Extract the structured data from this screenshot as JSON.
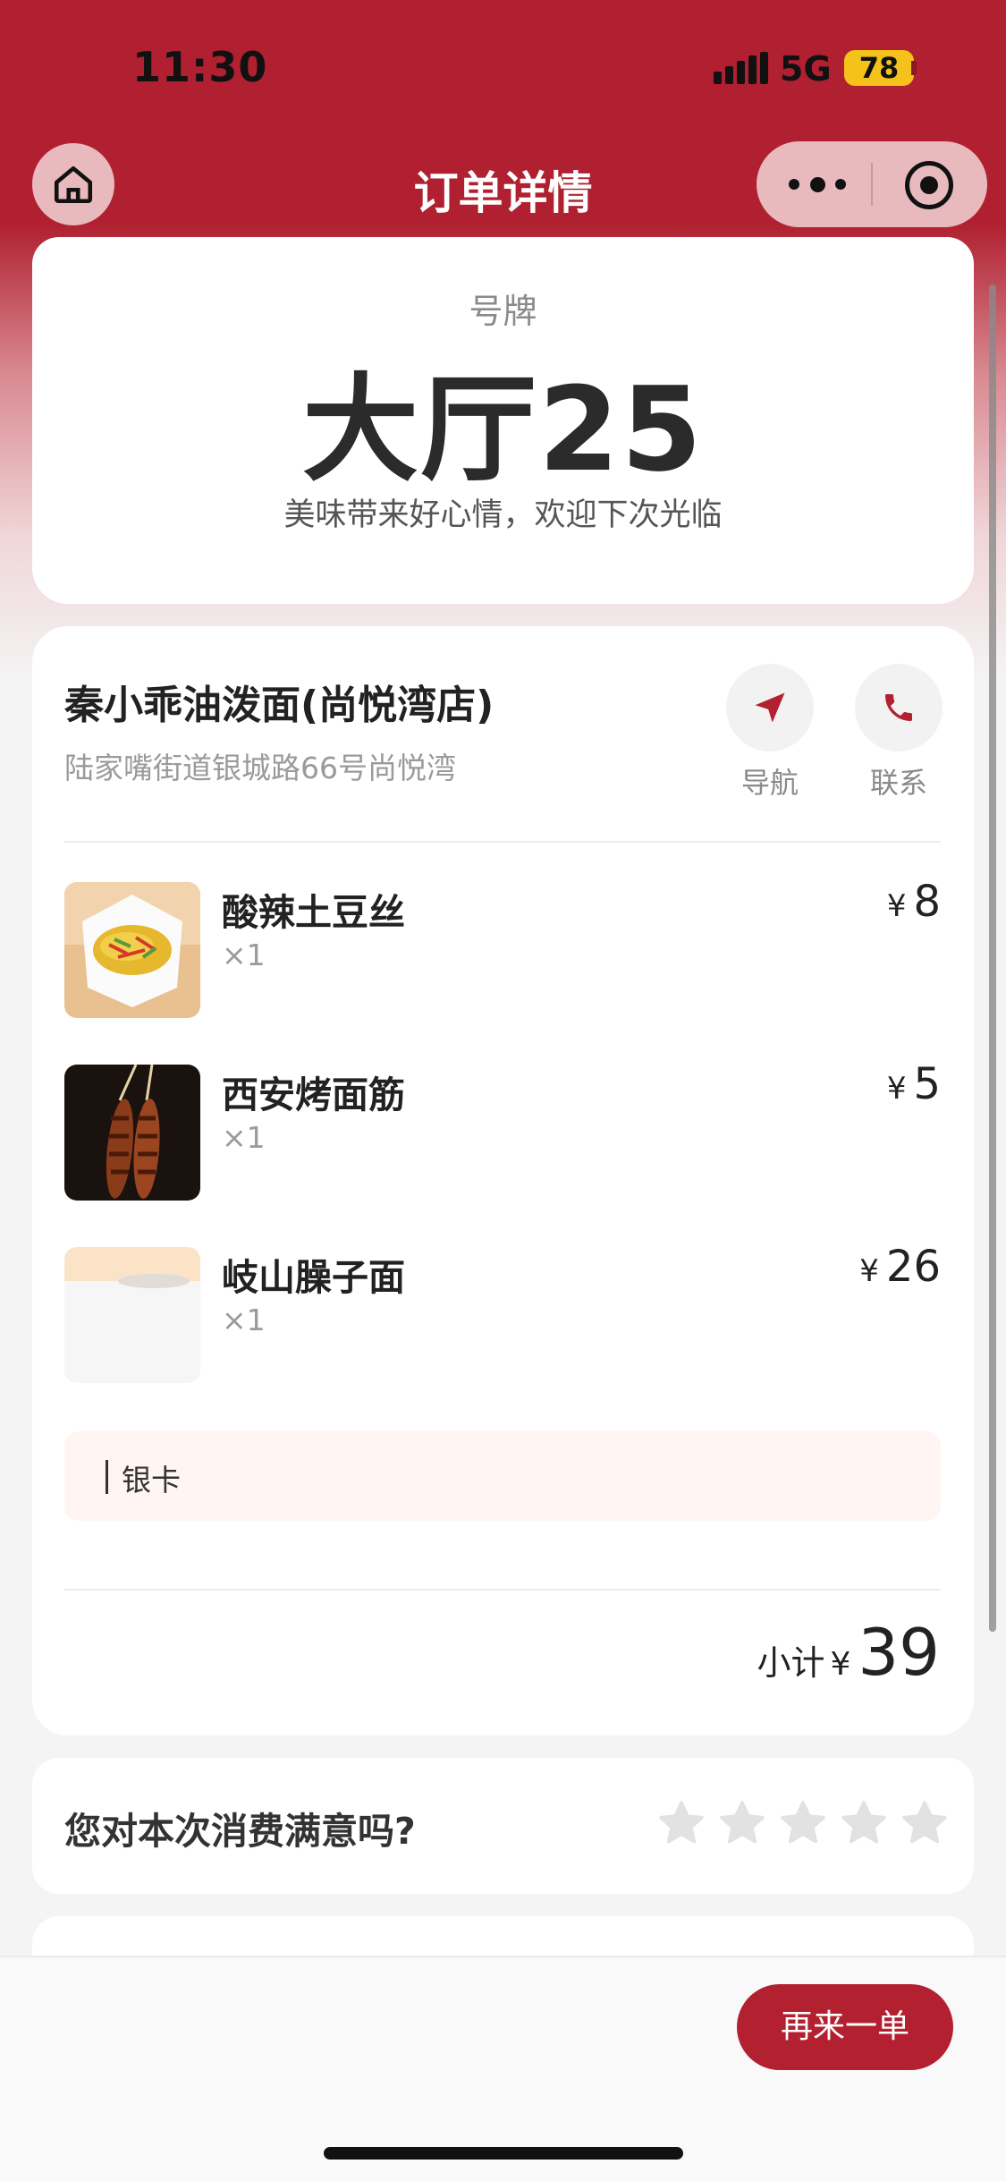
{
  "status_bar": {
    "time": "11:30",
    "network": "5G",
    "battery": "78"
  },
  "nav": {
    "title": "订单详情",
    "home_icon": "home-icon",
    "more_icon": "more-dots-icon",
    "target_icon": "target-icon"
  },
  "ticket": {
    "label": "号牌",
    "number": "大厅25",
    "message": "美味带来好心情，欢迎下次光临"
  },
  "store": {
    "name": "秦小乖油泼面(尚悦湾店)",
    "address": "陆家嘴街道银城路66号尚悦湾",
    "navigate_label": "导航",
    "contact_label": "联系",
    "accent": "#b3202f"
  },
  "items": [
    {
      "name": "酸辣土豆丝",
      "qty": "×1",
      "currency": "¥",
      "price": "8"
    },
    {
      "name": "西安烤面筋",
      "qty": "×1",
      "currency": "¥",
      "price": "5"
    },
    {
      "name": "岐山臊子面",
      "qty": "×1",
      "currency": "¥",
      "price": "26"
    }
  ],
  "card_note": "银卡",
  "subtotal": {
    "label": "小计",
    "currency": "¥",
    "amount": "39"
  },
  "rating": {
    "question": "您对本次消费满意吗?",
    "stars": 5,
    "selected": 0
  },
  "bottom": {
    "reorder_label": "再来一单"
  }
}
